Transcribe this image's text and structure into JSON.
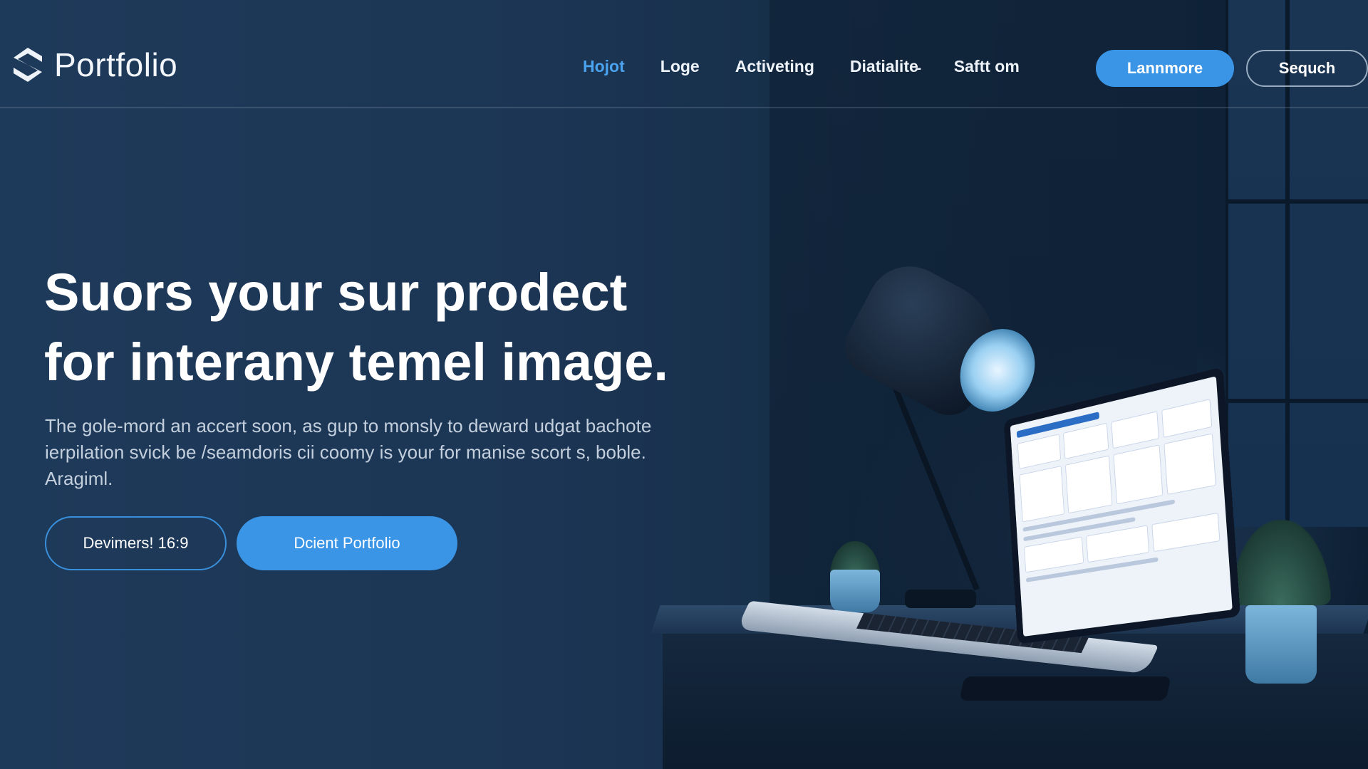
{
  "brand": {
    "name": "Portfolio",
    "logo_icon": "portfolio-logo-icon"
  },
  "nav": {
    "items": [
      {
        "label": "Hojot",
        "active": true
      },
      {
        "label": "Loge",
        "active": false
      },
      {
        "label": "Activeting",
        "active": false
      },
      {
        "label": "Diatialite̵",
        "active": false
      },
      {
        "label": "Saftt om",
        "active": false
      }
    ],
    "primary_button": "Lannmore",
    "secondary_button": "Sequch"
  },
  "hero": {
    "title_line1": "Suors your sur prodect",
    "title_line2": "for interany temel image.",
    "subtitle": "The gole-mord an accert soon, as gup to monsly to deward udgat bachote ierpilation svick be /seamdoris cii coomy is your for manise scort s, boble. Aragiml.",
    "cta_outline": "Devimers! 16:9",
    "cta_primary": "Dcient Portfolio"
  },
  "colors": {
    "accent": "#3a95e6",
    "active_link": "#4ba2ee",
    "background": "#1b3350"
  }
}
